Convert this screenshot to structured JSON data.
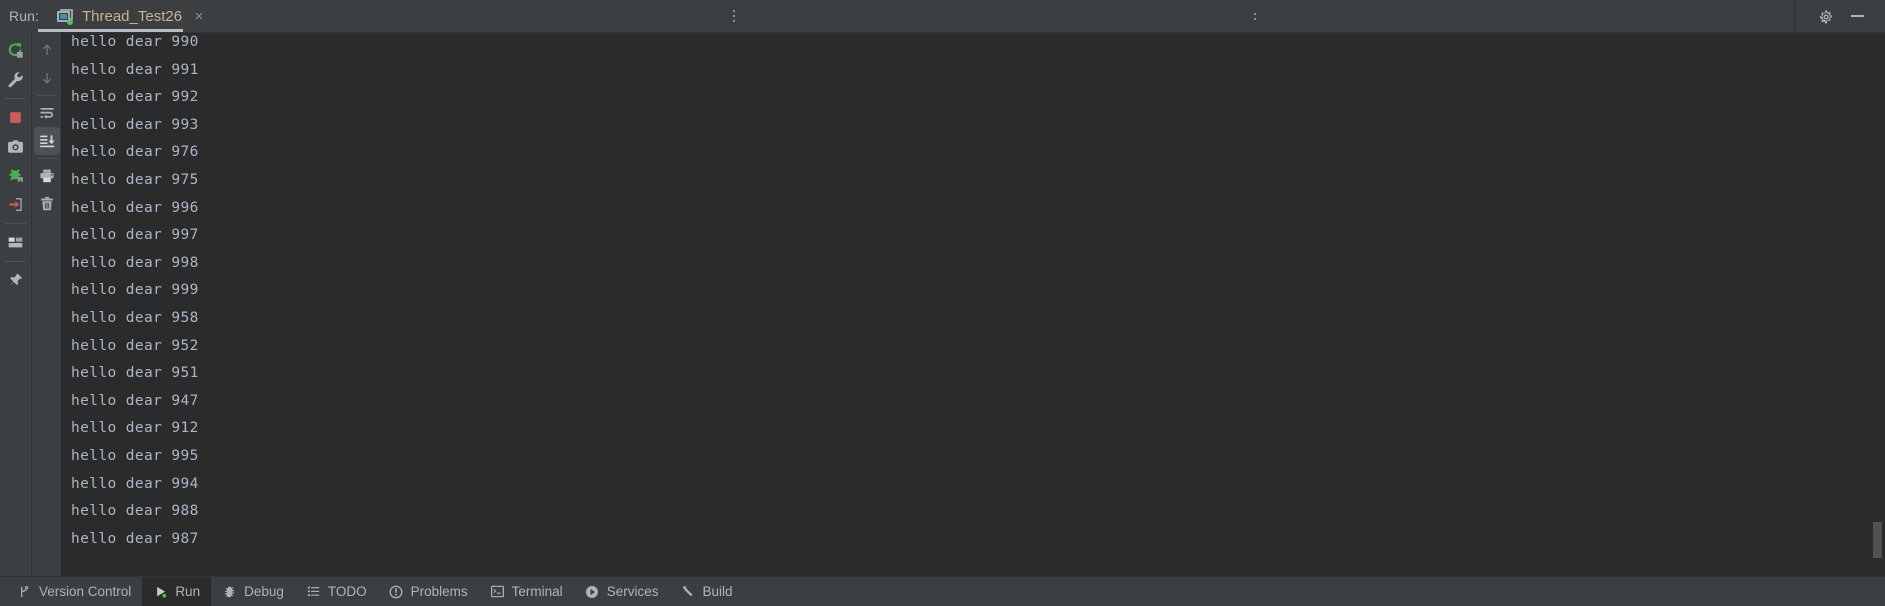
{
  "window": {
    "run_label": "Run:",
    "tab": {
      "title": "Thread_Test26",
      "close_label": "×",
      "icon": "console-window-icon",
      "status_dot_color": "#4ec94e"
    },
    "settings_icon": "gear-icon",
    "minimize_icon": "minimize-icon"
  },
  "left_toolbar": {
    "items": [
      {
        "name": "rerun-icon",
        "label": "Rerun",
        "color": "#4caf50"
      },
      {
        "name": "wrench-icon",
        "label": "Modify Run Configuration",
        "color": "#b4b7ba"
      },
      {
        "name": "stop-icon",
        "label": "Stop",
        "color": "#cf5b56"
      },
      {
        "name": "camera-icon",
        "label": "Capture Memory Snapshot",
        "color": "#b4b7ba"
      },
      {
        "name": "attach-debugger-icon",
        "label": "Attach Debugger to Process",
        "color": "#4caf50"
      },
      {
        "name": "export-icon",
        "label": "Export Thread Dump",
        "color": "#cf5b56"
      },
      {
        "name": "layout-icon",
        "label": "Layout Settings",
        "color": "#b4b7ba"
      },
      {
        "name": "pin-icon",
        "label": "Pin Tab",
        "color": "#b4b7ba"
      }
    ]
  },
  "console_toolbar": {
    "items": [
      {
        "name": "arrow-up-icon",
        "label": "Up the Stack Trace",
        "active": false
      },
      {
        "name": "arrow-down-icon",
        "label": "Down the Stack Trace",
        "active": false
      },
      {
        "name": "soft-wrap-icon",
        "label": "Use Soft Wraps",
        "active": false
      },
      {
        "name": "scroll-to-end-icon",
        "label": "Scroll to the End",
        "active": true
      },
      {
        "name": "print-icon",
        "label": "Print",
        "active": false
      },
      {
        "name": "trash-icon",
        "label": "Clear All",
        "active": false
      }
    ]
  },
  "console": {
    "lines": [
      "hello dear 990",
      "hello dear 991",
      "hello dear 992",
      "hello dear 993",
      "hello dear 976",
      "hello dear 975",
      "hello dear 996",
      "hello dear 997",
      "hello dear 998",
      "hello dear 999",
      "hello dear 958",
      "hello dear 952",
      "hello dear 951",
      "hello dear 947",
      "hello dear 912",
      "hello dear 995",
      "hello dear 994",
      "hello dear 988",
      "hello dear 987"
    ],
    "text_color": "#a9b7c6",
    "background_color": "#2b2b2b"
  },
  "status_tabs": [
    {
      "label": "Version Control",
      "icon": "branch-icon",
      "active": false
    },
    {
      "label": "Run",
      "icon": "run-play-icon",
      "active": true
    },
    {
      "label": "Debug",
      "icon": "bug-icon",
      "active": false
    },
    {
      "label": "TODO",
      "icon": "todo-list-icon",
      "active": false
    },
    {
      "label": "Problems",
      "icon": "problems-warning-icon",
      "active": false
    },
    {
      "label": "Terminal",
      "icon": "terminal-icon",
      "active": false
    },
    {
      "label": "Services",
      "icon": "services-icon",
      "active": false
    },
    {
      "label": "Build",
      "icon": "build-hammer-icon",
      "active": false
    }
  ],
  "theme": {
    "chrome_bg": "#3c3f41",
    "editor_bg": "#2b2b2b",
    "accent_tab_title": "#c9b58a",
    "text": "#b0b4b8"
  }
}
